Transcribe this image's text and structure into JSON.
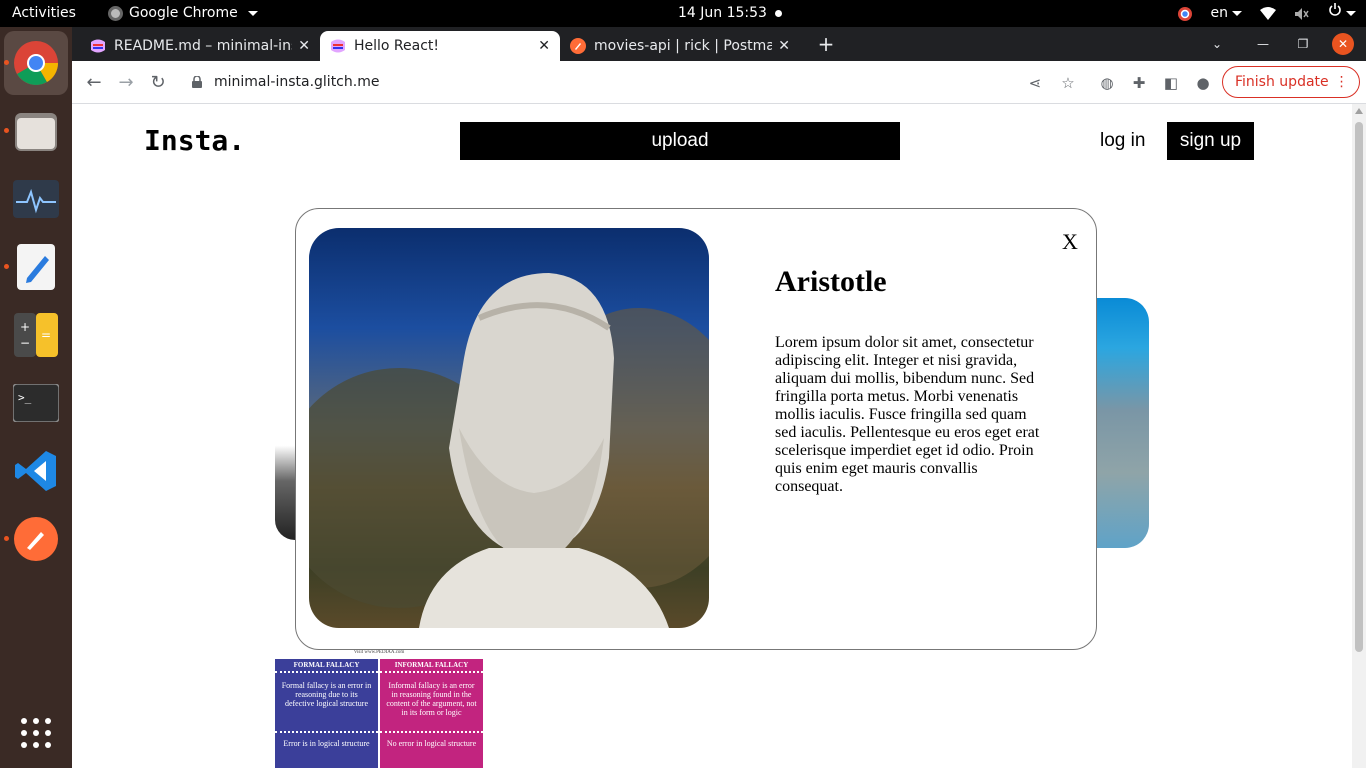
{
  "topbar": {
    "activities": "Activities",
    "app_name": "Google Chrome",
    "clock": "14 Jun  15:53",
    "language": "en"
  },
  "dock": {
    "apps": [
      "chrome-icon",
      "files-icon",
      "system-monitor-icon",
      "text-editor-icon",
      "calculator-icon",
      "terminal-icon",
      "vscode-icon",
      "postman-icon"
    ]
  },
  "browser": {
    "tabs": [
      {
        "title": "README.md – minimal-insta",
        "active": false
      },
      {
        "title": "Hello React!",
        "active": true
      },
      {
        "title": "movies-api | rick | Postman",
        "active": false
      }
    ],
    "url": "minimal-insta.glitch.me",
    "finish_update": "Finish update"
  },
  "page": {
    "logo": "Insta.",
    "upload": "upload",
    "login": "log in",
    "signup": "sign up",
    "infographic": {
      "source": "Visit www.PEDIAA.com",
      "left": {
        "heading": "FORMAL FALLACY",
        "body": "Formal fallacy is an error in reasoning due to its defective logical structure",
        "footer": "Error is in logical structure",
        "color": "#3b3f9a"
      },
      "right": {
        "heading": "INFORMAL FALLACY",
        "body": "Informal fallacy is an error in reasoning found in the content of the argument, not in its form or logic",
        "footer": "No error in logical structure",
        "color": "#c2247f"
      }
    }
  },
  "modal": {
    "close": "X",
    "title": "Aristotle",
    "body": "Lorem ipsum dolor sit amet, consectetur adipiscing elit. Integer et nisi gravida, aliquam dui mollis, bibendum nunc. Sed fringilla porta metus. Morbi venenatis mollis iaculis. Fusce fringilla sed quam sed iaculis. Pellentesque eu eros eget erat scelerisque imperdiet eget id odio. Proin quis enim eget mauris convallis consequat."
  },
  "colors": {
    "ubuntu_orange": "#e95420",
    "dock_bg": "#3a2a25",
    "update_red": "#d93025"
  }
}
